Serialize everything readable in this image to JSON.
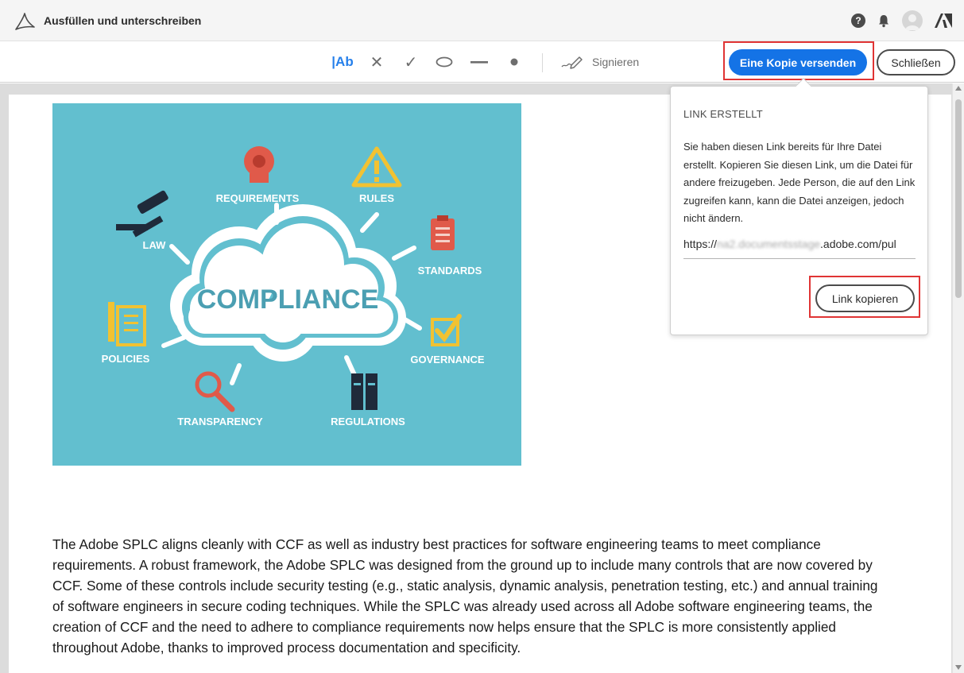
{
  "header": {
    "title": "Ausfüllen und unterschreiben",
    "help_glyph": "?",
    "icons": [
      "acrobat-logo-icon",
      "help-icon",
      "bell-icon",
      "avatar",
      "adobe-icon"
    ]
  },
  "toolbar": {
    "text_tool_label": "|Ab",
    "cross_tool_glyph": "✕",
    "check_tool_glyph": "✓",
    "sign_label": "Signieren",
    "send_copy_label": "Eine Kopie versenden",
    "close_label": "Schließen",
    "colors": {
      "accent": "#1473e6",
      "highlight": "#e03434",
      "text_tool": "#2680eb"
    }
  },
  "document": {
    "image": {
      "center_label": "COMPLIANCE",
      "labels": [
        "REQUIREMENTS",
        "RULES",
        "LAW",
        "STANDARDS",
        "POLICIES",
        "GOVERNANCE",
        "TRANSPARENCY",
        "REGULATIONS"
      ],
      "background_color": "#62bfcf"
    },
    "paragraph": "The Adobe SPLC aligns cleanly with CCF as well as industry best practices for software engineering teams to meet compliance requirements. A robust framework, the Adobe SPLC was designed from the ground up to include many controls that are now covered by CCF. Some of these controls include security testing (e.g., static analysis, dynamic analysis, penetration testing, etc.) and annual training of software engineers in secure coding techniques. While the SPLC was already used across all Adobe software engineering teams, the creation of CCF and the need to adhere to compliance requirements now helps ensure that the SPLC is more consistently applied throughout Adobe, thanks to improved process documentation and specificity."
  },
  "popover": {
    "title": "LINK ERSTELLT",
    "message": "Sie haben diesen Link bereits für Ihre Datei erstellt. Kopieren Sie diesen Link, um die Datei für andere freizugeben. Jede Person, die auf den Link zugreifen kann, kann die Datei anzeigen, jedoch nicht ändern.",
    "link_prefix": "https://",
    "link_blurred": "na2.documentsstage",
    "link_suffix": ".adobe.com/pul",
    "copy_label": "Link kopieren"
  }
}
